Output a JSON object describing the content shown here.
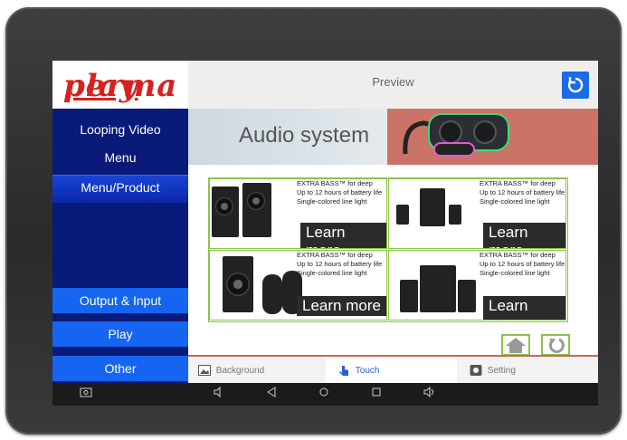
{
  "sidebar": {
    "logo_prefix": "perma",
    "logo_suffix": "play",
    "items": [
      {
        "label": "Looping Video"
      },
      {
        "label": "Menu"
      },
      {
        "label": "Menu/Product"
      }
    ],
    "buttons": [
      {
        "label": "Output & Input"
      },
      {
        "label": "Play"
      },
      {
        "label": "Other"
      }
    ]
  },
  "topbar": {
    "title": "Preview"
  },
  "banner": {
    "title": "Audio system"
  },
  "products": [
    {
      "line1": "EXTRA BASS™ for deep",
      "line2": "Up to 12 hours of battery life",
      "line3": "Single-colored line light",
      "cta": "Learn more"
    },
    {
      "line1": "EXTRA BASS™ for deep",
      "line2": "Up to 12 hours of battery life",
      "line3": "Single-colored line light",
      "cta": "Learn more"
    },
    {
      "line1": "EXTRA BASS™ for deep",
      "line2": "Up to 12 hours of battery life",
      "line3": "Single-colored line light",
      "cta": "Learn more"
    },
    {
      "line1": "EXTRA BASS™ for deep",
      "line2": "Up to 12 hours of battery life",
      "line3": "Single-colored line light",
      "cta": "Learn more"
    }
  ],
  "tabs": [
    {
      "label": "Background",
      "icon": "image-icon"
    },
    {
      "label": "Touch",
      "icon": "touch-icon",
      "active": true
    },
    {
      "label": "Setting",
      "icon": "gear-icon"
    }
  ],
  "colors": {
    "accent": "#1a6be8",
    "sidebar": "#0a1a78",
    "logo_red": "#d8201f",
    "grid_green": "#8bc34a"
  }
}
